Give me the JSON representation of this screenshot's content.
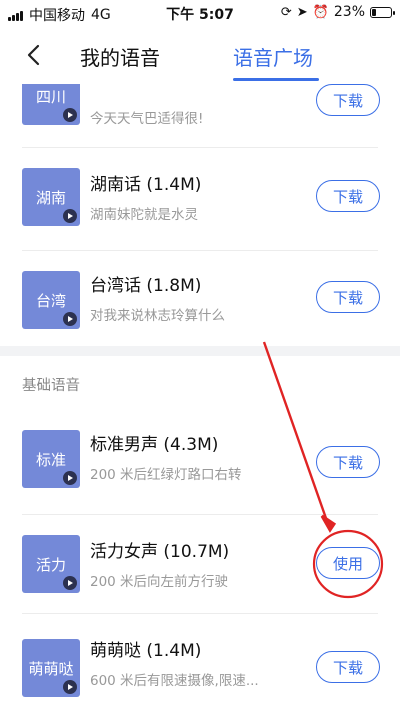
{
  "status_bar": {
    "carrier": "中国移动",
    "network": "4G",
    "time": "下午 5:07",
    "battery": "23%",
    "battery_level": 0.23
  },
  "nav": {
    "tab_mine": "我的语音",
    "tab_square": "语音广场",
    "active_color": "#3b6fe6"
  },
  "rows": [
    {
      "thumb": "四川",
      "name": "",
      "desc": "今天天气巴适得很!",
      "action": "下载"
    },
    {
      "thumb": "湖南",
      "name": "湖南话 (1.4M)",
      "desc": "湖南妹陀就是水灵",
      "action": "下载"
    },
    {
      "thumb": "台湾",
      "name": "台湾话 (1.8M)",
      "desc": "对我来说林志玲算什么",
      "action": "下载"
    },
    {
      "thumb": "标准",
      "name": "标准男声 (4.3M)",
      "desc": "200 米后红绿灯路口右转",
      "action": "下载"
    },
    {
      "thumb": "活力",
      "name": "活力女声 (10.7M)",
      "desc": "200 米后向左前方行驶",
      "action": "使用"
    },
    {
      "thumb": "萌萌哒",
      "name": "萌萌哒 (1.4M)",
      "desc": "600 米后有限速摄像,限速...",
      "action": "下载"
    }
  ],
  "section": {
    "basic_title": "基础语音"
  },
  "colors": {
    "thumb_bg": "#7489d8",
    "accent": "#3b6fe6",
    "annotation": "#e02424"
  }
}
